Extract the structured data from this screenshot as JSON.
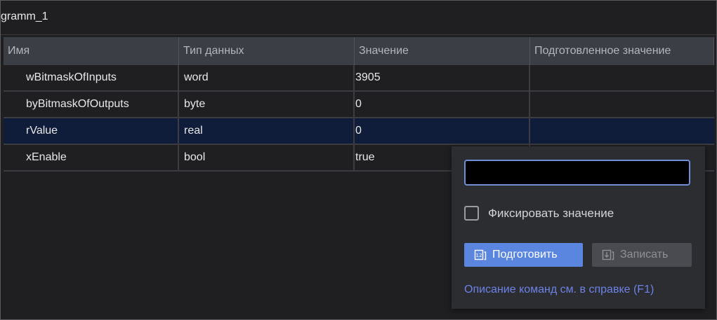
{
  "window": {
    "title": "gramm_1"
  },
  "table": {
    "columns": [
      "Имя",
      "Тип данных",
      "Значение",
      "Подготовленное значение"
    ],
    "rows": [
      {
        "name": "wBitmaskOfInputs",
        "type": "word",
        "value": "3905",
        "prepared": ""
      },
      {
        "name": "byBitmaskOfOutputs",
        "type": "byte",
        "value": "0",
        "prepared": ""
      },
      {
        "name": "rValue",
        "type": "real",
        "value": "0",
        "prepared": ""
      },
      {
        "name": "xEnable",
        "type": "bool",
        "value": "true",
        "prepared": ""
      }
    ],
    "selected_row": "rValue"
  },
  "popup": {
    "input_value": "",
    "checkbox_label": "Фиксировать значение",
    "checkbox_checked": false,
    "prepare_label": "Подготовить",
    "write_label": "Записать",
    "help_text": "Описание команд см. в справке (F1)"
  },
  "icons": {
    "prepare": "prepare-value-icon",
    "write": "write-value-icon"
  },
  "colors": {
    "selection": "#0f1d3a",
    "accent": "#5b86e0",
    "link": "#6e82e6"
  }
}
